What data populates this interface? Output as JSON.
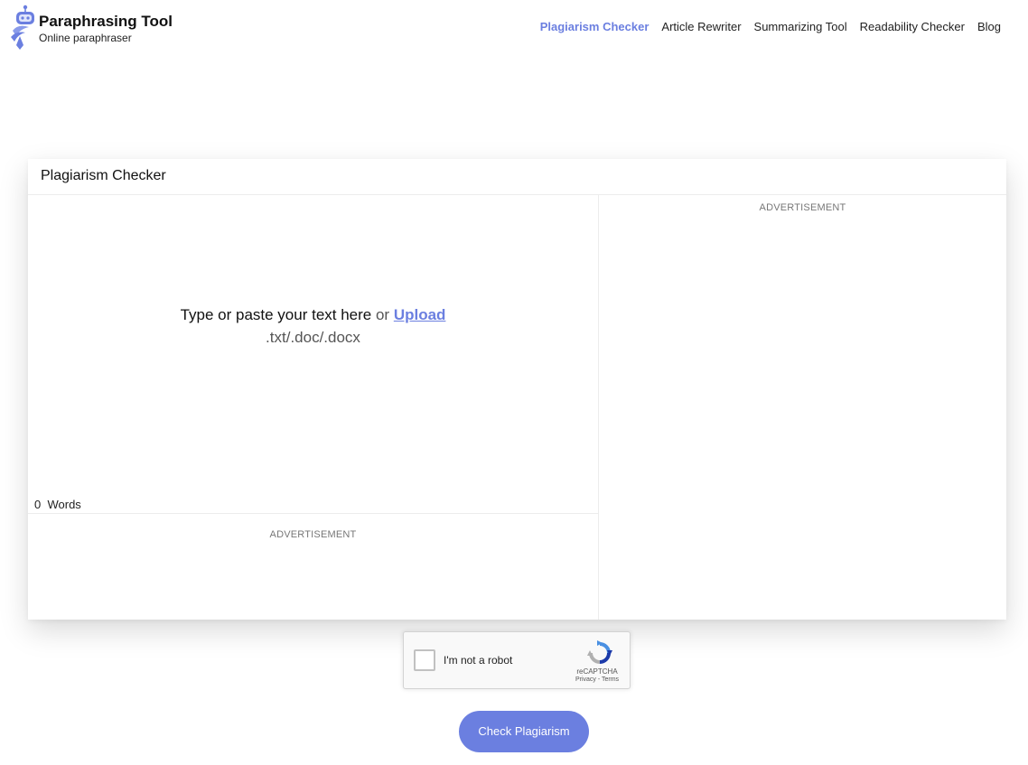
{
  "brand": {
    "title": "Paraphrasing Tool",
    "subtitle": "Online paraphraser",
    "accent_color": "#6b7fe0"
  },
  "nav": {
    "items": [
      {
        "label": "Plagiarism Checker",
        "active": true
      },
      {
        "label": "Article Rewriter",
        "active": false
      },
      {
        "label": "Summarizing Tool",
        "active": false
      },
      {
        "label": "Readability Checker",
        "active": false
      },
      {
        "label": "Blog",
        "active": false
      }
    ]
  },
  "card": {
    "title": "Plagiarism Checker",
    "prompt_main": "Type or paste your text here",
    "prompt_or": " or ",
    "upload_label": "Upload",
    "formats": ".txt/.doc/.docx",
    "word_count": "0",
    "word_label": "Words",
    "ad_left": "ADVERTISEMENT",
    "ad_right": "ADVERTISEMENT"
  },
  "captcha": {
    "label": "I'm not a robot",
    "brand": "reCAPTCHA",
    "links": "Privacy - Terms"
  },
  "action": {
    "check_label": "Check Plagiarism"
  }
}
